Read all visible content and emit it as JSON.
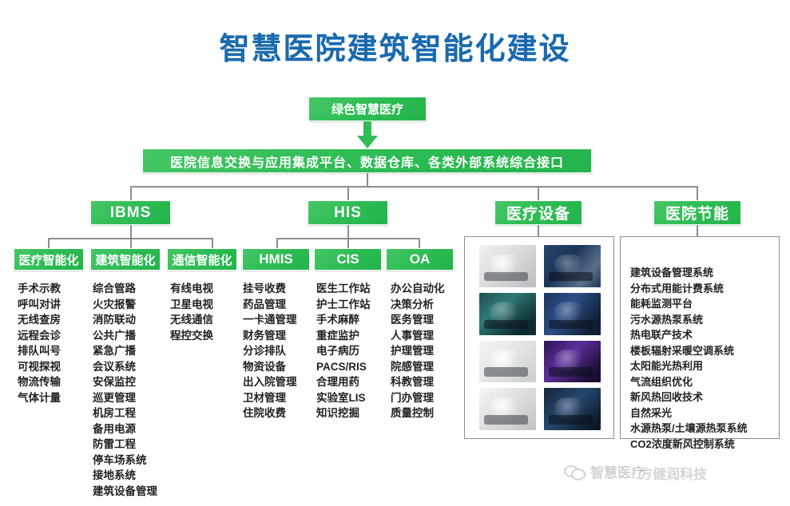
{
  "title": "智慧医院建筑智能化建设",
  "root": {
    "label": "绿色智慧医疗"
  },
  "platform": {
    "label": "医院信息交换与应用集成平台、数据仓库、各类外部系统综合接口"
  },
  "branches": [
    {
      "label": "IBMS"
    },
    {
      "label": "HIS"
    },
    {
      "label": "医疗设备"
    },
    {
      "label": "医院节能"
    }
  ],
  "ibms": {
    "children": [
      {
        "label": "医疗智能化",
        "items": [
          "手术示教",
          "呼叫对讲",
          "无线查房",
          "远程会诊",
          "排队叫号",
          "可视探视",
          "物流传输",
          "气体计量"
        ]
      },
      {
        "label": "建筑智能化",
        "items": [
          "综合管路",
          "火灾报警",
          "消防联动",
          "公共广播",
          "紧急广播",
          "会议系统",
          "安保监控",
          "巡更管理",
          "机房工程",
          "备用电源",
          "防雷工程",
          "停车场系统",
          "接地系统",
          "建筑设备管理"
        ]
      },
      {
        "label": "通信智能化",
        "items": [
          "有线电视",
          "卫星电视",
          "无线通信",
          "程控交换"
        ]
      }
    ]
  },
  "his": {
    "children": [
      {
        "label": "HMIS",
        "items": [
          "挂号收费",
          "药品管理",
          "一卡通管理",
          "财务管理",
          "分诊排队",
          "物资设备",
          "出入院管理",
          "卫材管理",
          "住院收费"
        ]
      },
      {
        "label": "CIS",
        "items": [
          "医生工作站",
          "护士工作站",
          "手术麻醉",
          "重症监护",
          "电子病历",
          "PACS/RIS",
          "合理用药",
          "实验室LIS",
          "知识挖掘"
        ]
      },
      {
        "label": "OA",
        "items": [
          "办公自动化",
          "决策分析",
          "医务管理",
          "人事管理",
          "护理管理",
          "院感管理",
          "科教管理",
          "门办管理",
          "质量控制"
        ]
      }
    ]
  },
  "medical_devices": {
    "photos": [
      {
        "name": "ct-scanner-photo"
      },
      {
        "name": "mri-bore-photo"
      },
      {
        "name": "nuclear-medicine-scanner-photo"
      },
      {
        "name": "linear-accelerator-photo"
      },
      {
        "name": "ultrasound-workstation-photo"
      },
      {
        "name": "particle-accelerator-photo"
      },
      {
        "name": "c-arm-angiography-photo"
      },
      {
        "name": "control-console-monitors-photo"
      }
    ]
  },
  "energy": {
    "items": [
      "建筑设备管理系统",
      "分布式用能计费系统",
      "能耗监测平台",
      "污水源热泵系统",
      "热电联产技术",
      "楼板辐射采暖空调系统",
      "太阳能光热利用",
      "气流组织优化",
      "新风热回收技术",
      "自然采光",
      "水源热泵/土壤源热泵系统",
      "CO2浓度新风控制系统"
    ]
  },
  "watermark": {
    "brand": "智慧医疗",
    "brand2": "方健润科技"
  },
  "colors": {
    "green": "#2fbd55",
    "green_light": "#46c666",
    "title_blue": "#1a6aad",
    "line_gray": "#8d8d8d",
    "text_dark": "#231f20"
  }
}
